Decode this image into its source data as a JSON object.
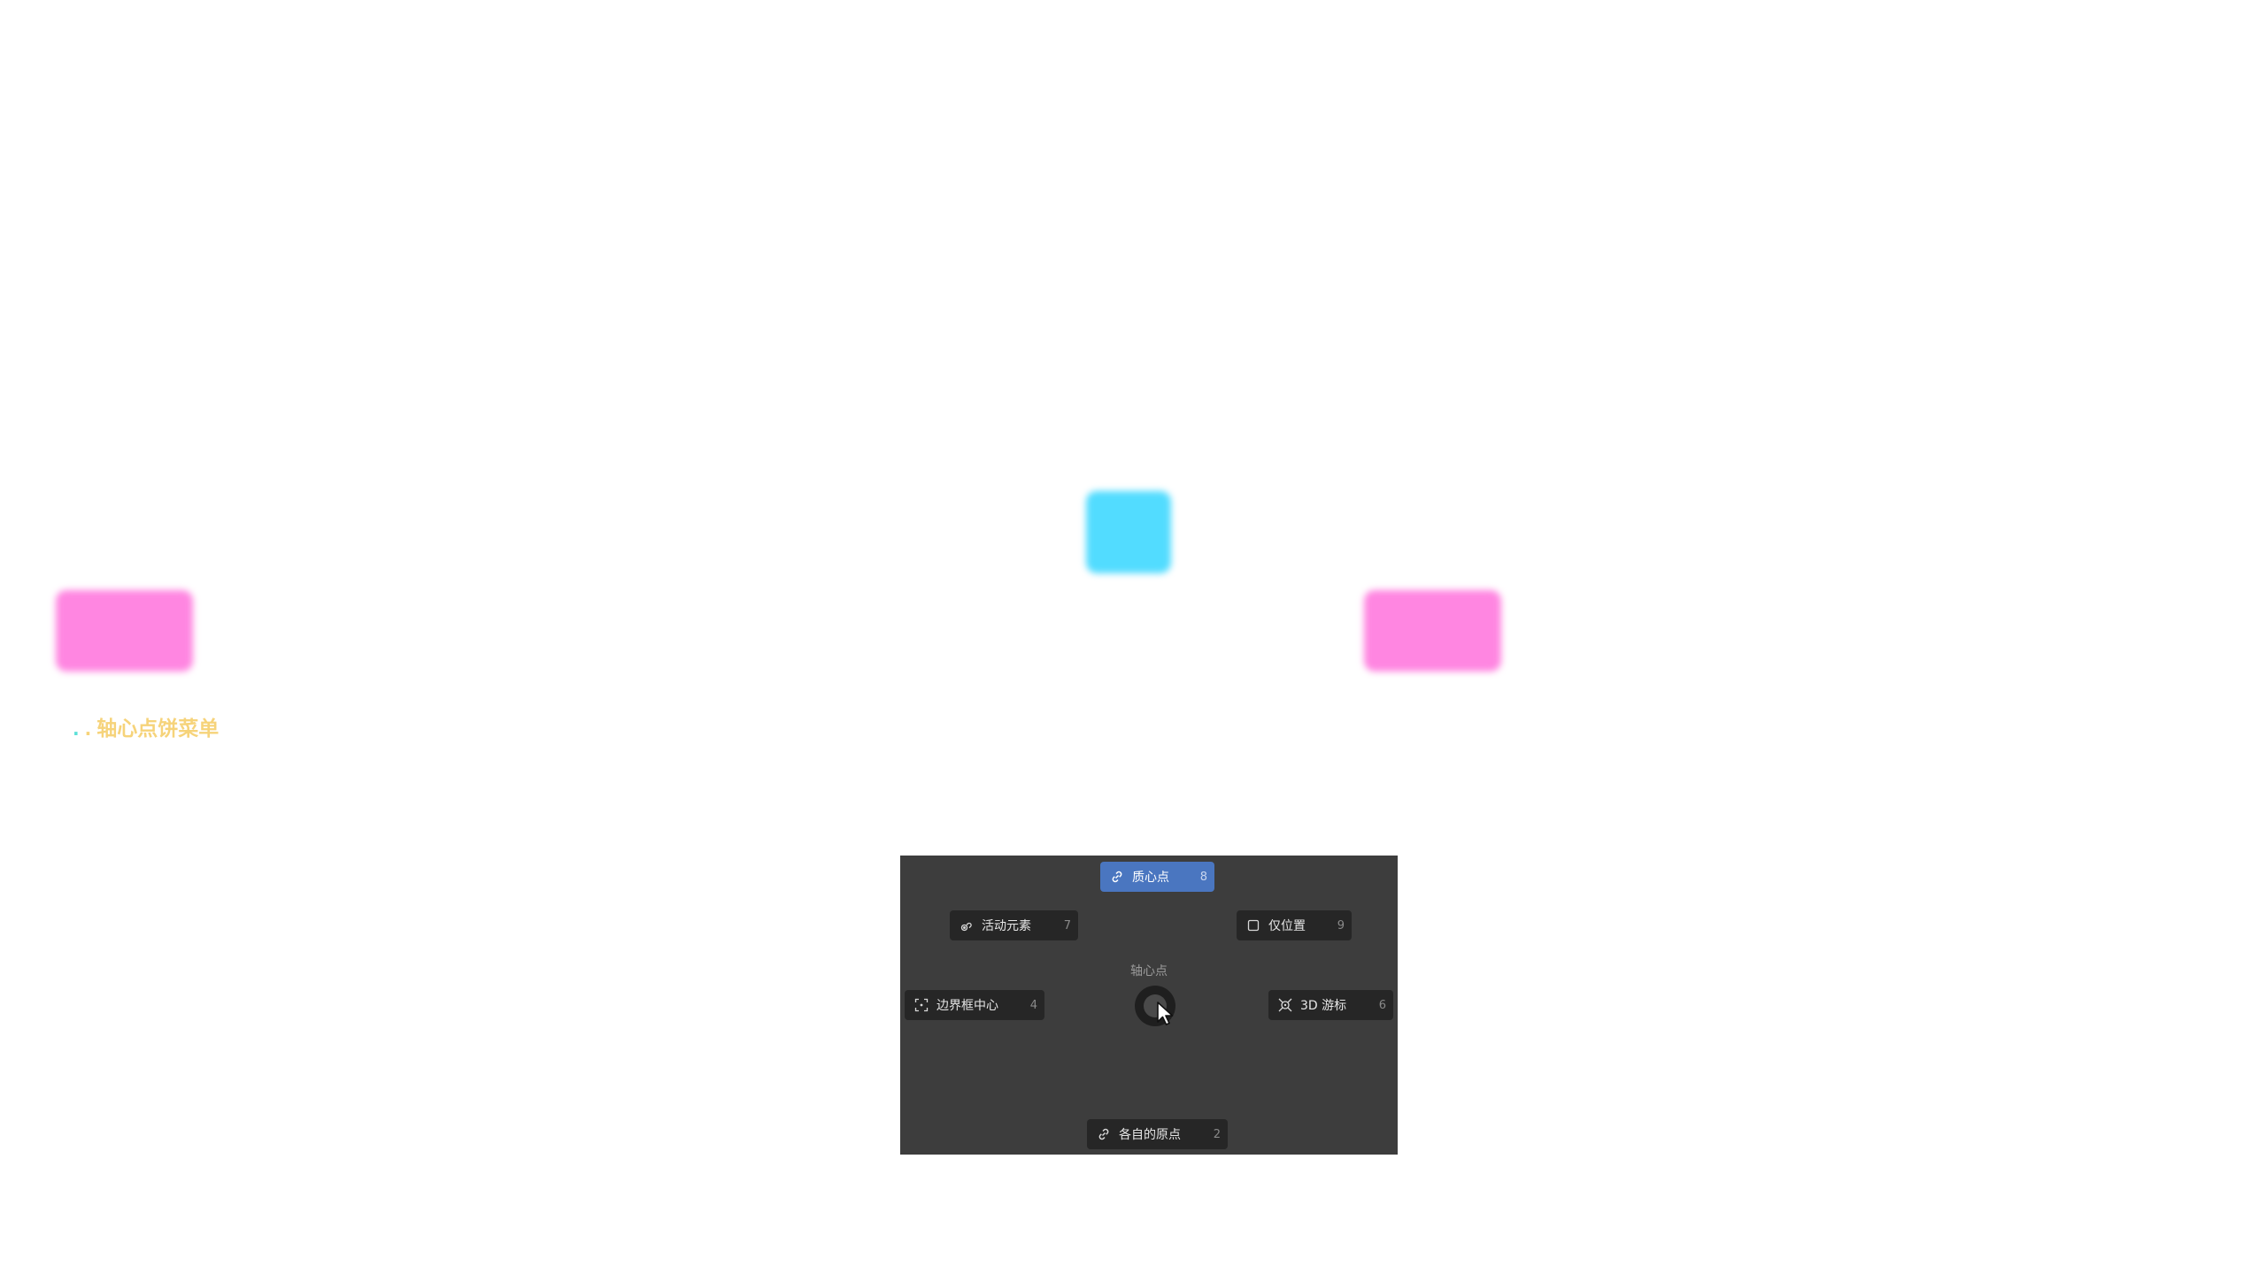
{
  "caption": {
    "dot1": ".",
    "dot2": ".",
    "text": "轴心点饼菜单"
  },
  "pie_menu": {
    "title": "轴心点",
    "items": {
      "top": {
        "label": "质心点",
        "key": "8",
        "icon": "link-icon",
        "active": true
      },
      "top_left": {
        "label": "活动元素",
        "key": "7",
        "icon": "active-element-icon"
      },
      "top_right": {
        "label": "仅位置",
        "key": "9",
        "icon": "checkbox-icon"
      },
      "left": {
        "label": "边界框中心",
        "key": "4",
        "icon": "bounding-box-icon"
      },
      "right": {
        "label": "3D 游标",
        "key": "6",
        "icon": "cursor-3d-icon"
      },
      "bottom": {
        "label": "各自的原点",
        "key": "2",
        "icon": "link-icon"
      }
    }
  },
  "colors": {
    "panel_bg": "#3d3d3d",
    "item_bg": "#262626",
    "active_bg": "#4a76c0",
    "cyan_shape": "#52dcff",
    "pink_shape": "#ff86e1",
    "caption_text": "#f6d37a"
  }
}
